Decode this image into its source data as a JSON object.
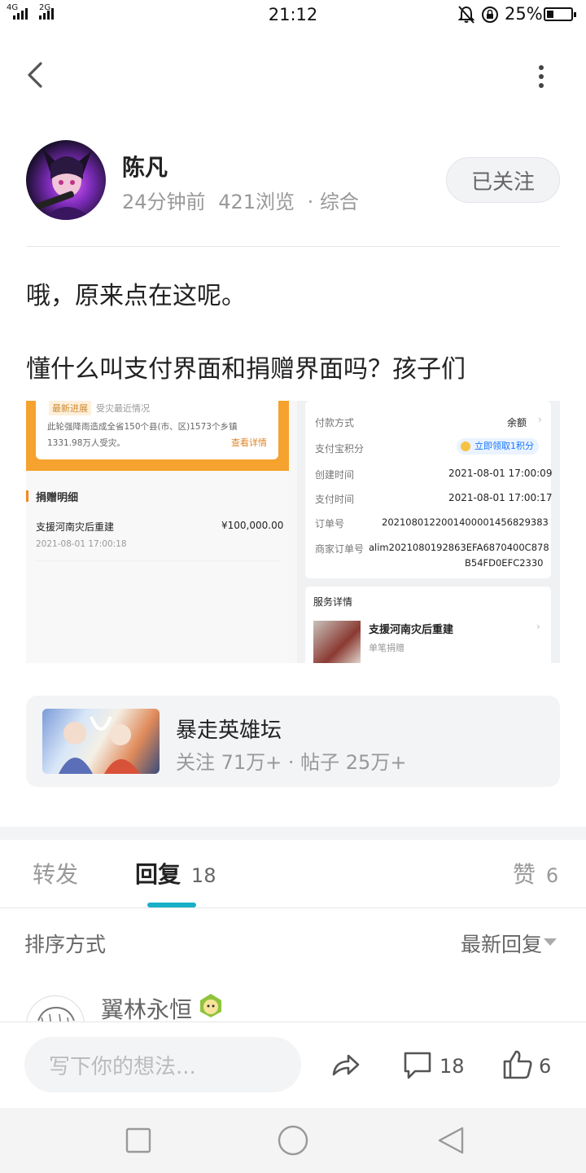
{
  "status_bar": {
    "signal1": "4G",
    "signal2": "2G",
    "time": "21:12",
    "battery": "25%",
    "battery_level": 0.25
  },
  "nav": {
    "back_icon": "back-chevron-icon",
    "more_icon": "more-vertical-icon"
  },
  "post": {
    "author": "陈凡",
    "time": "24分钟前",
    "views": "421浏览",
    "category": "· 综合",
    "follow_label": "已关注",
    "paragraph1": "哦，原来点在这呢。",
    "paragraph2": "懂什么叫支付界面和捐赠界面吗？孩子们"
  },
  "embed": {
    "left": {
      "tag1": "最新进展",
      "tag2": "受灾最近情况",
      "notice_line1": "此轮强降雨造成全省150个县(市、区)1573个乡镇",
      "notice_line2": "1331.98万人受灾。",
      "details_link": "查看详情",
      "section_title": "捐赠明细",
      "item_name": "支援河南灾后重建",
      "item_amount": "¥100,000.00",
      "item_time": "2021-08-01 17:00:18"
    },
    "right": {
      "rows": [
        {
          "label": "付款方式",
          "value": "余额"
        },
        {
          "label": "支付宝积分",
          "value": "立即领取1积分"
        },
        {
          "label": "创建时间",
          "value": "2021-08-01 17:00:09"
        },
        {
          "label": "支付时间",
          "value": "2021-08-01 17:00:17"
        },
        {
          "label": "订单号",
          "value": "20210801220014000014568293​83"
        },
        {
          "label": "商家订单号",
          "value": "alim2021080192863EFA6870400C878"
        }
      ],
      "order_no": "2021080122001400001456829383",
      "merchant_line2": "B54FD0EFC2330",
      "service_title": "服务详情",
      "service_name": "支援河南灾后重建",
      "service_sub": "单笔捐赠"
    }
  },
  "forum": {
    "name": "暴走英雄坛",
    "stats": "关注 71万+ · 帖子 25万+"
  },
  "tabs": {
    "repost": "转发",
    "reply": "回复",
    "reply_count": "18",
    "like": "赞",
    "like_count": "6"
  },
  "sort": {
    "label": "排序方式",
    "value": "最新回复"
  },
  "comment": {
    "user": "翼林永恒"
  },
  "bottom_bar": {
    "placeholder": "写下你的想法...",
    "comment_count": "18",
    "like_count": "6"
  }
}
